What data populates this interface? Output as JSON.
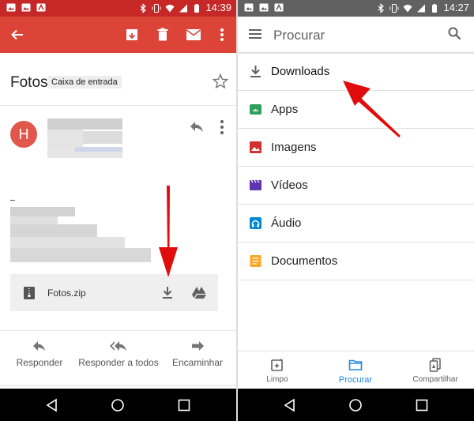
{
  "left_screen": {
    "status_bar": {
      "time": "14:39"
    },
    "toolbar": {
      "back_icon": "arrow-left-icon",
      "archive_icon": "archive-icon",
      "delete_icon": "trash-icon",
      "mail_icon": "mail-icon",
      "more_icon": "more-vert-icon"
    },
    "email": {
      "subject": "Fotos",
      "label": "Caixa de entrada",
      "sender_initial": "H",
      "attachment": {
        "name": "Fotos.zip"
      }
    },
    "actions": [
      {
        "label": "Responder",
        "icon": "reply-icon"
      },
      {
        "label": "Responder a todos",
        "icon": "reply-all-icon"
      },
      {
        "label": "Encaminhar",
        "icon": "forward-icon"
      }
    ]
  },
  "right_screen": {
    "status_bar": {
      "time": "14:27"
    },
    "toolbar": {
      "title": "Procurar"
    },
    "list": [
      {
        "label": "Downloads",
        "icon": "download-icon",
        "color": "#616161"
      },
      {
        "label": "Apps",
        "icon": "android-icon",
        "color": "#2e9f5f"
      },
      {
        "label": "Imagens",
        "icon": "image-icon",
        "color": "#d32f2f"
      },
      {
        "label": "Vídeos",
        "icon": "video-icon",
        "color": "#5e35b1"
      },
      {
        "label": "Áudio",
        "icon": "audio-icon",
        "color": "#0288d1"
      },
      {
        "label": "Documentos",
        "icon": "document-icon",
        "color": "#f9a825"
      }
    ],
    "bottom_nav": [
      {
        "label": "Limpo",
        "icon": "clean-icon"
      },
      {
        "label": "Procurar",
        "icon": "folder-icon",
        "active": true
      },
      {
        "label": "Compartilhar",
        "icon": "share-icon"
      }
    ]
  },
  "colors": {
    "gmail_red": "#db4437",
    "status_red": "#c62828",
    "accent_blue": "#1e88e5",
    "annotation_red": "#e10d0d"
  }
}
